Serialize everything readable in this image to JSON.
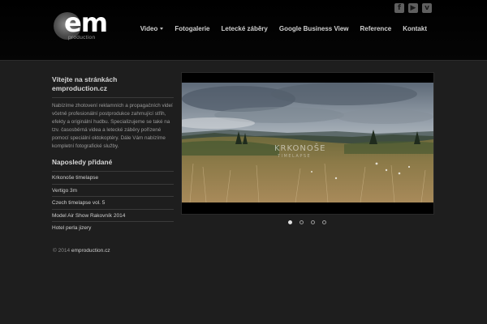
{
  "logo": {
    "text": "em",
    "subtext": "production"
  },
  "social": [
    {
      "icon": "facebook-icon",
      "glyph": "f"
    },
    {
      "icon": "youtube-icon",
      "glyph": "▶"
    },
    {
      "icon": "vimeo-icon",
      "glyph": "v"
    }
  ],
  "nav": {
    "items": [
      {
        "label": "Video",
        "has_dropdown": true
      },
      {
        "label": "Fotogalerie"
      },
      {
        "label": "Letecké záběry"
      },
      {
        "label": "Google Business View"
      },
      {
        "label": "Reference"
      },
      {
        "label": "Kontakt"
      }
    ]
  },
  "sidebar": {
    "welcome_title": "Vítejte na stránkách emproduction.cz",
    "welcome_text": "Nabízíme zhotovení reklamních a propagačních videí včetně profesionální postprodukce zahrnující střih, efekty a originální hudbu. Specializujeme se také na tzv. časosběrná videa a letecké záběry pořízené pomocí speciální oktokoptéry. Dále Vám nabízíme kompletní fotografické služby.",
    "recent_title": "Naposledy přidané",
    "recent_items": [
      "Krkonoše timelapse",
      "Vertigo 3m",
      "Czech timelapse vol. 5",
      "Model Air Show Rakovník 2014",
      "Hotel perla jizery"
    ]
  },
  "slider": {
    "caption": "KRKONOŠE",
    "caption_sub": "TIMELAPSE",
    "slide_count": 4,
    "active_index": 0
  },
  "footer": {
    "copyright_prefix": "© 2014",
    "site": "emproduction.cz"
  },
  "colors": {
    "background": "#1e1e1e",
    "header": "#000000",
    "text": "#d0d0d0"
  }
}
